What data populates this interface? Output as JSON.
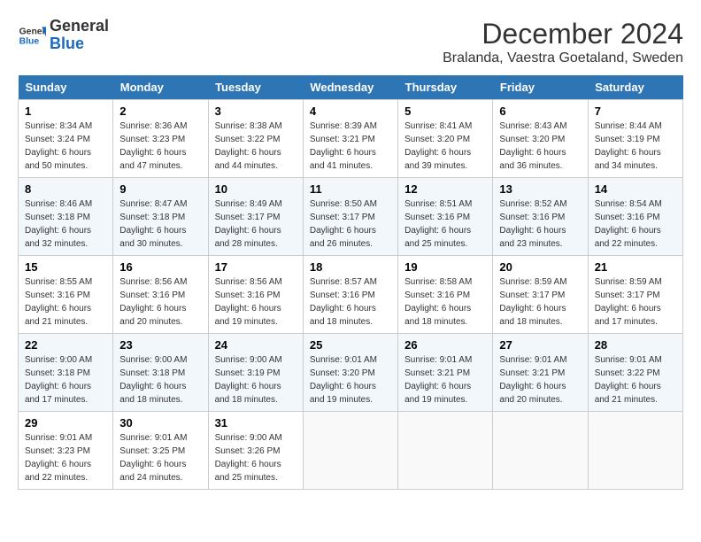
{
  "logo": {
    "line1": "General",
    "line2": "Blue"
  },
  "title": "December 2024",
  "subtitle": "Bralanda, Vaestra Goetaland, Sweden",
  "days_header": [
    "Sunday",
    "Monday",
    "Tuesday",
    "Wednesday",
    "Thursday",
    "Friday",
    "Saturday"
  ],
  "weeks": [
    [
      {
        "day": "1",
        "sunrise": "8:34 AM",
        "sunset": "3:24 PM",
        "daylight": "6 hours and 50 minutes."
      },
      {
        "day": "2",
        "sunrise": "8:36 AM",
        "sunset": "3:23 PM",
        "daylight": "6 hours and 47 minutes."
      },
      {
        "day": "3",
        "sunrise": "8:38 AM",
        "sunset": "3:22 PM",
        "daylight": "6 hours and 44 minutes."
      },
      {
        "day": "4",
        "sunrise": "8:39 AM",
        "sunset": "3:21 PM",
        "daylight": "6 hours and 41 minutes."
      },
      {
        "day": "5",
        "sunrise": "8:41 AM",
        "sunset": "3:20 PM",
        "daylight": "6 hours and 39 minutes."
      },
      {
        "day": "6",
        "sunrise": "8:43 AM",
        "sunset": "3:20 PM",
        "daylight": "6 hours and 36 minutes."
      },
      {
        "day": "7",
        "sunrise": "8:44 AM",
        "sunset": "3:19 PM",
        "daylight": "6 hours and 34 minutes."
      }
    ],
    [
      {
        "day": "8",
        "sunrise": "8:46 AM",
        "sunset": "3:18 PM",
        "daylight": "6 hours and 32 minutes."
      },
      {
        "day": "9",
        "sunrise": "8:47 AM",
        "sunset": "3:18 PM",
        "daylight": "6 hours and 30 minutes."
      },
      {
        "day": "10",
        "sunrise": "8:49 AM",
        "sunset": "3:17 PM",
        "daylight": "6 hours and 28 minutes."
      },
      {
        "day": "11",
        "sunrise": "8:50 AM",
        "sunset": "3:17 PM",
        "daylight": "6 hours and 26 minutes."
      },
      {
        "day": "12",
        "sunrise": "8:51 AM",
        "sunset": "3:16 PM",
        "daylight": "6 hours and 25 minutes."
      },
      {
        "day": "13",
        "sunrise": "8:52 AM",
        "sunset": "3:16 PM",
        "daylight": "6 hours and 23 minutes."
      },
      {
        "day": "14",
        "sunrise": "8:54 AM",
        "sunset": "3:16 PM",
        "daylight": "6 hours and 22 minutes."
      }
    ],
    [
      {
        "day": "15",
        "sunrise": "8:55 AM",
        "sunset": "3:16 PM",
        "daylight": "6 hours and 21 minutes."
      },
      {
        "day": "16",
        "sunrise": "8:56 AM",
        "sunset": "3:16 PM",
        "daylight": "6 hours and 20 minutes."
      },
      {
        "day": "17",
        "sunrise": "8:56 AM",
        "sunset": "3:16 PM",
        "daylight": "6 hours and 19 minutes."
      },
      {
        "day": "18",
        "sunrise": "8:57 AM",
        "sunset": "3:16 PM",
        "daylight": "6 hours and 18 minutes."
      },
      {
        "day": "19",
        "sunrise": "8:58 AM",
        "sunset": "3:16 PM",
        "daylight": "6 hours and 18 minutes."
      },
      {
        "day": "20",
        "sunrise": "8:59 AM",
        "sunset": "3:17 PM",
        "daylight": "6 hours and 18 minutes."
      },
      {
        "day": "21",
        "sunrise": "8:59 AM",
        "sunset": "3:17 PM",
        "daylight": "6 hours and 17 minutes."
      }
    ],
    [
      {
        "day": "22",
        "sunrise": "9:00 AM",
        "sunset": "3:18 PM",
        "daylight": "6 hours and 17 minutes."
      },
      {
        "day": "23",
        "sunrise": "9:00 AM",
        "sunset": "3:18 PM",
        "daylight": "6 hours and 18 minutes."
      },
      {
        "day": "24",
        "sunrise": "9:00 AM",
        "sunset": "3:19 PM",
        "daylight": "6 hours and 18 minutes."
      },
      {
        "day": "25",
        "sunrise": "9:01 AM",
        "sunset": "3:20 PM",
        "daylight": "6 hours and 19 minutes."
      },
      {
        "day": "26",
        "sunrise": "9:01 AM",
        "sunset": "3:21 PM",
        "daylight": "6 hours and 19 minutes."
      },
      {
        "day": "27",
        "sunrise": "9:01 AM",
        "sunset": "3:21 PM",
        "daylight": "6 hours and 20 minutes."
      },
      {
        "day": "28",
        "sunrise": "9:01 AM",
        "sunset": "3:22 PM",
        "daylight": "6 hours and 21 minutes."
      }
    ],
    [
      {
        "day": "29",
        "sunrise": "9:01 AM",
        "sunset": "3:23 PM",
        "daylight": "6 hours and 22 minutes."
      },
      {
        "day": "30",
        "sunrise": "9:01 AM",
        "sunset": "3:25 PM",
        "daylight": "6 hours and 24 minutes."
      },
      {
        "day": "31",
        "sunrise": "9:00 AM",
        "sunset": "3:26 PM",
        "daylight": "6 hours and 25 minutes."
      },
      null,
      null,
      null,
      null
    ]
  ]
}
